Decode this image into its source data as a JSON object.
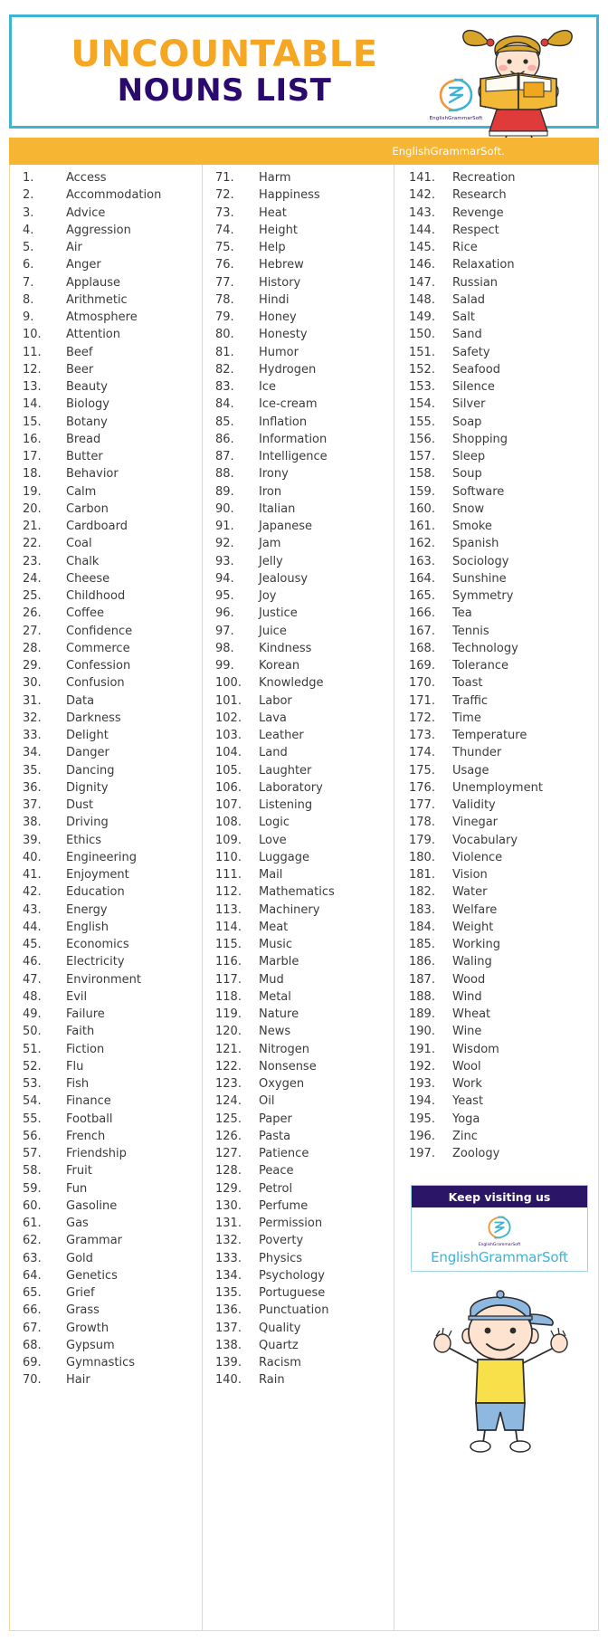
{
  "header": {
    "title_line1": "UNCOUNTABLE",
    "title_line2": "NOUNS LIST",
    "brand_mark_word": "EnglishGrammarSoft",
    "girl_illustration_name": "girl-reading-book-illustration"
  },
  "strip": {
    "brand_text": "EnglishGrammarSoft."
  },
  "footer_box": {
    "heading": "Keep visiting us",
    "brand": "EnglishGrammarSoft",
    "logo_word": "EnglishGrammarSoft",
    "boy_illustration_name": "boy-waving-illustration"
  },
  "colors": {
    "accent_orange": "#f5a623",
    "strip_orange": "#f7b534",
    "navy": "#2b0a6e",
    "cyan_border": "#3fb3d4",
    "table_border": "#f0d89a",
    "text_gray": "#3b3b3b"
  },
  "columns": [
    {
      "id": "column-1",
      "items": [
        {
          "num": "1.",
          "word": "Access"
        },
        {
          "num": "2.",
          "word": "Accommodation"
        },
        {
          "num": "3.",
          "word": "Advice"
        },
        {
          "num": "4.",
          "word": "Aggression"
        },
        {
          "num": "5.",
          "word": "Air"
        },
        {
          "num": "6.",
          "word": "Anger"
        },
        {
          "num": "7.",
          "word": "Applause"
        },
        {
          "num": "8.",
          "word": "Arithmetic"
        },
        {
          "num": "9.",
          "word": "Atmosphere"
        },
        {
          "num": "10.",
          "word": "Attention"
        },
        {
          "num": "11.",
          "word": "Beef"
        },
        {
          "num": "12.",
          "word": "Beer"
        },
        {
          "num": "13.",
          "word": "Beauty"
        },
        {
          "num": "14.",
          "word": "Biology"
        },
        {
          "num": "15.",
          "word": "Botany"
        },
        {
          "num": "16.",
          "word": "Bread"
        },
        {
          "num": "17.",
          "word": "Butter"
        },
        {
          "num": "18.",
          "word": "Behavior"
        },
        {
          "num": "19.",
          "word": "Calm"
        },
        {
          "num": "20.",
          "word": "Carbon"
        },
        {
          "num": "21.",
          "word": "Cardboard"
        },
        {
          "num": "22.",
          "word": "Coal"
        },
        {
          "num": "23.",
          "word": "Chalk"
        },
        {
          "num": "24.",
          "word": "Cheese"
        },
        {
          "num": "25.",
          "word": "Childhood"
        },
        {
          "num": "26.",
          "word": "Coffee"
        },
        {
          "num": "27.",
          "word": "Confidence"
        },
        {
          "num": "28.",
          "word": "Commerce"
        },
        {
          "num": "29.",
          "word": "Confession"
        },
        {
          "num": "30.",
          "word": "Confusion"
        },
        {
          "num": "31.",
          "word": "Data"
        },
        {
          "num": "32.",
          "word": "Darkness"
        },
        {
          "num": "33.",
          "word": "Delight"
        },
        {
          "num": "34.",
          "word": "Danger"
        },
        {
          "num": "35.",
          "word": "Dancing"
        },
        {
          "num": "36.",
          "word": "Dignity"
        },
        {
          "num": "37.",
          "word": "Dust"
        },
        {
          "num": "38.",
          "word": "Driving"
        },
        {
          "num": "39.",
          "word": "Ethics"
        },
        {
          "num": "40.",
          "word": "Engineering"
        },
        {
          "num": "41.",
          "word": "Enjoyment"
        },
        {
          "num": "42.",
          "word": "Education"
        },
        {
          "num": "43.",
          "word": "Energy"
        },
        {
          "num": "44.",
          "word": "English"
        },
        {
          "num": "45.",
          "word": "Economics"
        },
        {
          "num": "46.",
          "word": "Electricity"
        },
        {
          "num": "47.",
          "word": "Environment"
        },
        {
          "num": "48.",
          "word": "Evil"
        },
        {
          "num": "49.",
          "word": "Failure"
        },
        {
          "num": "50.",
          "word": "Faith"
        },
        {
          "num": "51.",
          "word": "Fiction"
        },
        {
          "num": "52.",
          "word": "Flu"
        },
        {
          "num": "53.",
          "word": "Fish"
        },
        {
          "num": "54.",
          "word": "Finance"
        },
        {
          "num": "55.",
          "word": "Football"
        },
        {
          "num": "56.",
          "word": "French"
        },
        {
          "num": "57.",
          "word": "Friendship"
        },
        {
          "num": "58.",
          "word": "Fruit"
        },
        {
          "num": "59.",
          "word": "Fun"
        },
        {
          "num": "60.",
          "word": "Gasoline"
        },
        {
          "num": "61.",
          "word": "Gas"
        },
        {
          "num": "62.",
          "word": "Grammar"
        },
        {
          "num": "63.",
          "word": "Gold"
        },
        {
          "num": "64.",
          "word": "Genetics"
        },
        {
          "num": "65.",
          "word": "Grief"
        },
        {
          "num": "66.",
          "word": "Grass"
        },
        {
          "num": "67.",
          "word": "Growth"
        },
        {
          "num": "68.",
          "word": "Gypsum"
        },
        {
          "num": "69.",
          "word": "Gymnastics"
        },
        {
          "num": "70.",
          "word": "Hair"
        }
      ]
    },
    {
      "id": "column-2",
      "items": [
        {
          "num": "71.",
          "word": "Harm"
        },
        {
          "num": "72.",
          "word": "Happiness"
        },
        {
          "num": "73.",
          "word": "Heat"
        },
        {
          "num": "74.",
          "word": "Height"
        },
        {
          "num": "75.",
          "word": "Help"
        },
        {
          "num": "76.",
          "word": "Hebrew"
        },
        {
          "num": "77.",
          "word": "History"
        },
        {
          "num": "78.",
          "word": "Hindi"
        },
        {
          "num": "79.",
          "word": "Honey"
        },
        {
          "num": "80.",
          "word": "Honesty"
        },
        {
          "num": "81.",
          "word": "Humor"
        },
        {
          "num": "82.",
          "word": "Hydrogen"
        },
        {
          "num": "83.",
          "word": "Ice"
        },
        {
          "num": "84.",
          "word": "Ice-cream"
        },
        {
          "num": "85.",
          "word": "Inflation"
        },
        {
          "num": "86.",
          "word": "Information"
        },
        {
          "num": "87.",
          "word": "Intelligence"
        },
        {
          "num": "88.",
          "word": "Irony"
        },
        {
          "num": "89.",
          "word": "Iron"
        },
        {
          "num": "90.",
          "word": "Italian"
        },
        {
          "num": "91.",
          "word": "Japanese"
        },
        {
          "num": "92.",
          "word": "Jam"
        },
        {
          "num": "93.",
          "word": "Jelly"
        },
        {
          "num": "94.",
          "word": "Jealousy"
        },
        {
          "num": "95.",
          "word": "Joy"
        },
        {
          "num": "96.",
          "word": "Justice"
        },
        {
          "num": "97.",
          "word": "Juice"
        },
        {
          "num": "98.",
          "word": "Kindness"
        },
        {
          "num": "99.",
          "word": "Korean"
        },
        {
          "num": "100.",
          "word": "Knowledge"
        },
        {
          "num": "101.",
          "word": "Labor"
        },
        {
          "num": "102.",
          "word": "Lava"
        },
        {
          "num": "103.",
          "word": "Leather"
        },
        {
          "num": "104.",
          "word": "Land"
        },
        {
          "num": "105.",
          "word": "Laughter"
        },
        {
          "num": "106.",
          "word": "Laboratory"
        },
        {
          "num": "107.",
          "word": "Listening"
        },
        {
          "num": "108.",
          "word": "Logic"
        },
        {
          "num": "109.",
          "word": "Love"
        },
        {
          "num": "110.",
          "word": "Luggage"
        },
        {
          "num": "111.",
          "word": "Mail"
        },
        {
          "num": "112.",
          "word": "Mathematics"
        },
        {
          "num": "113.",
          "word": "Machinery"
        },
        {
          "num": "114.",
          "word": "Meat"
        },
        {
          "num": "115.",
          "word": "Music"
        },
        {
          "num": "116.",
          "word": "Marble"
        },
        {
          "num": "117.",
          "word": "Mud"
        },
        {
          "num": "118.",
          "word": "Metal"
        },
        {
          "num": "119.",
          "word": "Nature"
        },
        {
          "num": "120.",
          "word": "News"
        },
        {
          "num": "121.",
          "word": "Nitrogen"
        },
        {
          "num": "122.",
          "word": "Nonsense"
        },
        {
          "num": "123.",
          "word": "Oxygen"
        },
        {
          "num": "124.",
          "word": "Oil"
        },
        {
          "num": "125.",
          "word": "Paper"
        },
        {
          "num": "126.",
          "word": "Pasta"
        },
        {
          "num": "127.",
          "word": "Patience"
        },
        {
          "num": "128.",
          "word": "Peace"
        },
        {
          "num": "129.",
          "word": "Petrol"
        },
        {
          "num": "130.",
          "word": "Perfume"
        },
        {
          "num": "131.",
          "word": "Permission"
        },
        {
          "num": "132.",
          "word": "Poverty"
        },
        {
          "num": "133.",
          "word": "Physics"
        },
        {
          "num": "134.",
          "word": "Psychology"
        },
        {
          "num": "135.",
          "word": "Portuguese"
        },
        {
          "num": "136.",
          "word": "Punctuation"
        },
        {
          "num": "137.",
          "word": "Quality"
        },
        {
          "num": "138.",
          "word": "Quartz"
        },
        {
          "num": "139.",
          "word": "Racism"
        },
        {
          "num": "140.",
          "word": "Rain"
        }
      ]
    },
    {
      "id": "column-3",
      "items": [
        {
          "num": "141.",
          "word": "Recreation"
        },
        {
          "num": "142.",
          "word": "Research"
        },
        {
          "num": "143.",
          "word": "Revenge"
        },
        {
          "num": "144.",
          "word": "Respect"
        },
        {
          "num": "145.",
          "word": "Rice"
        },
        {
          "num": "146.",
          "word": "Relaxation"
        },
        {
          "num": "147.",
          "word": "Russian"
        },
        {
          "num": "148.",
          "word": "Salad"
        },
        {
          "num": "149.",
          "word": "Salt"
        },
        {
          "num": "150.",
          "word": "Sand"
        },
        {
          "num": "151.",
          "word": "Safety"
        },
        {
          "num": "152.",
          "word": "Seafood"
        },
        {
          "num": "153.",
          "word": "Silence"
        },
        {
          "num": "154.",
          "word": "Silver"
        },
        {
          "num": "155.",
          "word": "Soap"
        },
        {
          "num": "156.",
          "word": "Shopping"
        },
        {
          "num": "157.",
          "word": "Sleep"
        },
        {
          "num": "158.",
          "word": "Soup"
        },
        {
          "num": "159.",
          "word": "Software"
        },
        {
          "num": "160.",
          "word": "Snow"
        },
        {
          "num": "161.",
          "word": "Smoke"
        },
        {
          "num": "162.",
          "word": "Spanish"
        },
        {
          "num": "163.",
          "word": "Sociology"
        },
        {
          "num": "164.",
          "word": "Sunshine"
        },
        {
          "num": "165.",
          "word": "Symmetry"
        },
        {
          "num": "166.",
          "word": "Tea"
        },
        {
          "num": "167.",
          "word": "Tennis"
        },
        {
          "num": "168.",
          "word": "Technology"
        },
        {
          "num": "169.",
          "word": "Tolerance"
        },
        {
          "num": "170.",
          "word": "Toast"
        },
        {
          "num": "171.",
          "word": "Traffic"
        },
        {
          "num": "172.",
          "word": "Time"
        },
        {
          "num": "173.",
          "word": "Temperature"
        },
        {
          "num": "174.",
          "word": "Thunder"
        },
        {
          "num": "175.",
          "word": "Usage"
        },
        {
          "num": "176.",
          "word": "Unemployment"
        },
        {
          "num": "177.",
          "word": "Validity"
        },
        {
          "num": "178.",
          "word": "Vinegar"
        },
        {
          "num": "179.",
          "word": "Vocabulary"
        },
        {
          "num": "180.",
          "word": "Violence"
        },
        {
          "num": "181.",
          "word": "Vision"
        },
        {
          "num": "182.",
          "word": "Water"
        },
        {
          "num": "183.",
          "word": "Welfare"
        },
        {
          "num": "184.",
          "word": "Weight"
        },
        {
          "num": "185.",
          "word": "Working"
        },
        {
          "num": "186.",
          "word": "Waling"
        },
        {
          "num": "187.",
          "word": "Wood"
        },
        {
          "num": "188.",
          "word": "Wind"
        },
        {
          "num": "189.",
          "word": "Wheat"
        },
        {
          "num": "190.",
          "word": "Wine"
        },
        {
          "num": "191.",
          "word": "Wisdom"
        },
        {
          "num": "192.",
          "word": "Wool"
        },
        {
          "num": "193.",
          "word": "Work"
        },
        {
          "num": "194.",
          "word": "Yeast"
        },
        {
          "num": "195.",
          "word": "Yoga"
        },
        {
          "num": "196.",
          "word": "Zinc"
        },
        {
          "num": "197.",
          "word": "Zoology"
        }
      ]
    }
  ]
}
